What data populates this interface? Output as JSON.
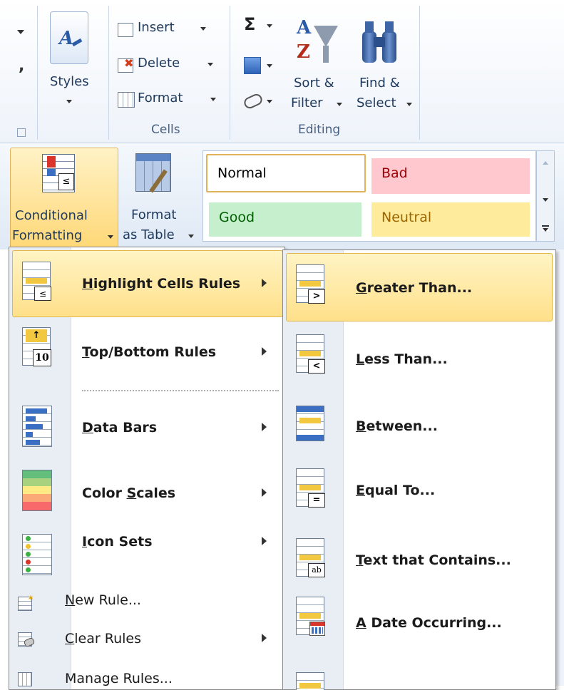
{
  "ribbon": {
    "styles_label": "Styles",
    "cells": {
      "insert_label": "Insert",
      "delete_label": "Delete",
      "format_label": "Format",
      "group_label": "Cells"
    },
    "editing": {
      "sort_label_1": "Sort &",
      "sort_label_2": "Filter",
      "find_label_1": "Find &",
      "find_label_2": "Select",
      "group_label": "Editing",
      "autosum_symbol": "Σ"
    },
    "conditional_formatting": {
      "line1": "Conditional",
      "line2": "Formatting"
    },
    "format_as_table": {
      "line1": "Format",
      "line2": "as Table"
    },
    "cell_styles": [
      {
        "name": "Normal",
        "bg": "#ffffff",
        "fg": "#000000"
      },
      {
        "name": "Bad",
        "bg": "#ffc7ce",
        "fg": "#9c0006"
      },
      {
        "name": "Good",
        "bg": "#c6efce",
        "fg": "#006100"
      },
      {
        "name": "Neutral",
        "bg": "#ffeb9c",
        "fg": "#9c6500"
      }
    ]
  },
  "menu": {
    "items": [
      {
        "pre": "",
        "key": "H",
        "post": "ighlight Cells Rules"
      },
      {
        "pre": "",
        "key": "T",
        "post": "op/Bottom Rules"
      },
      {
        "pre": "",
        "key": "D",
        "post": "ata Bars"
      },
      {
        "pre": "Color ",
        "key": "S",
        "post": "cales"
      },
      {
        "pre": "",
        "key": "I",
        "post": "con Sets"
      },
      {
        "pre": "",
        "key": "N",
        "post": "ew Rule..."
      },
      {
        "pre": "",
        "key": "C",
        "post": "lear Rules"
      },
      {
        "pre": "",
        "key": "",
        "post": "Manage Rules..."
      }
    ]
  },
  "submenu": {
    "items": [
      {
        "pre": "",
        "key": "G",
        "post": "reater Than..."
      },
      {
        "pre": "",
        "key": "L",
        "post": "ess Than..."
      },
      {
        "pre": "",
        "key": "B",
        "post": "etween..."
      },
      {
        "pre": "",
        "key": "E",
        "post": "qual To..."
      },
      {
        "pre": "",
        "key": "T",
        "post": "ext that Contains..."
      },
      {
        "pre": "",
        "key": "A",
        "post": " Date Occurring..."
      }
    ]
  },
  "colors": {
    "highlight": "#ffe08a",
    "ribbon_text": "#1e395b"
  }
}
